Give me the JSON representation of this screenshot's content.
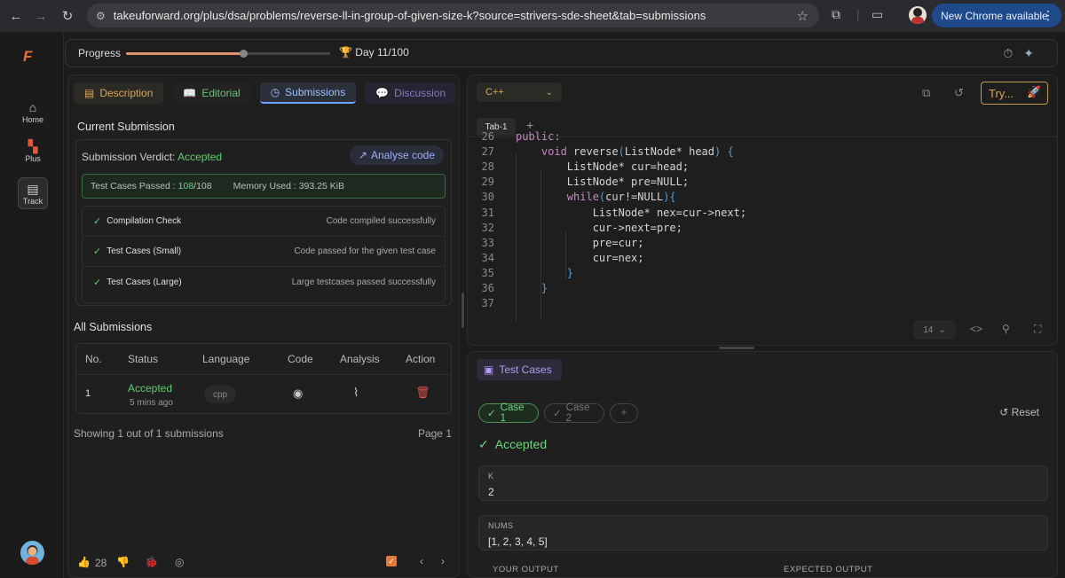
{
  "browser": {
    "url": "takeuforward.org/plus/dsa/problems/reverse-ll-in-group-of-given-size-k?source=strivers-sde-sheet&tab=submissions",
    "new_chrome": "New Chrome available"
  },
  "sidebar": {
    "logo": "F",
    "items": [
      {
        "label": "Home",
        "icon": "home-icon"
      },
      {
        "label": "Plus",
        "icon": "plus-grid-icon"
      },
      {
        "label": "Track",
        "icon": "track-doc-icon"
      }
    ]
  },
  "progress": {
    "label": "Progress",
    "day": "Day 11/100",
    "fraction": 0.11
  },
  "left_tabs": [
    "Description",
    "Editorial",
    "Submissions",
    "Discussion"
  ],
  "current_submission": {
    "title": "Current Submission",
    "verdict_label": "Submission Verdict:",
    "verdict": "Accepted",
    "analyse": "Analyse code",
    "tc_label": "Test Cases Passed :",
    "tc_passed": "108",
    "tc_total": "/108",
    "memory": "Memory Used : 393.25 KiB",
    "checks": [
      {
        "name": "Compilation Check",
        "desc": "Code compiled successfully"
      },
      {
        "name": "Test Cases (Small)",
        "desc": "Code passed for the given test case"
      },
      {
        "name": "Test Cases (Large)",
        "desc": "Large testcases passed successfully"
      }
    ]
  },
  "all_submissions": {
    "title": "All Submissions",
    "headers": [
      "No.",
      "Status",
      "Language",
      "Code",
      "Analysis",
      "Action"
    ],
    "rows": [
      {
        "no": "1",
        "status": "Accepted",
        "time": "5 mins ago",
        "language": "cpp"
      }
    ],
    "showing": "Showing 1 out of 1 submissions",
    "page": "Page 1"
  },
  "footer": {
    "likes": "28"
  },
  "editor": {
    "language": "C++",
    "try": "Try...",
    "tab": "Tab-1",
    "font_size": "14",
    "lines": [
      {
        "n": "26",
        "t": "public:"
      },
      {
        "n": "27",
        "t": "    void reverse(ListNode* head) {"
      },
      {
        "n": "28",
        "t": "        ListNode* cur=head;"
      },
      {
        "n": "29",
        "t": "        ListNode* pre=NULL;"
      },
      {
        "n": "30",
        "t": "        while(cur!=NULL){"
      },
      {
        "n": "31",
        "t": "            ListNode* nex=cur->next;"
      },
      {
        "n": "32",
        "t": "            cur->next=pre;"
      },
      {
        "n": "33",
        "t": "            pre=cur;"
      },
      {
        "n": "34",
        "t": "            cur=nex;"
      },
      {
        "n": "35",
        "t": "        }"
      },
      {
        "n": "36",
        "t": "    }"
      },
      {
        "n": "37",
        "t": ""
      }
    ]
  },
  "testcases": {
    "title": "Test Cases",
    "case1": "Case 1",
    "case2": "Case 2",
    "reset": "Reset",
    "verdict": "Accepted",
    "k_label": "K",
    "k_value": "2",
    "nums_label": "NUMS",
    "nums_value": "[1, 2, 3, 4, 5]",
    "your_output": "YOUR OUTPUT",
    "expected_output": "EXPECTED OUTPUT"
  }
}
